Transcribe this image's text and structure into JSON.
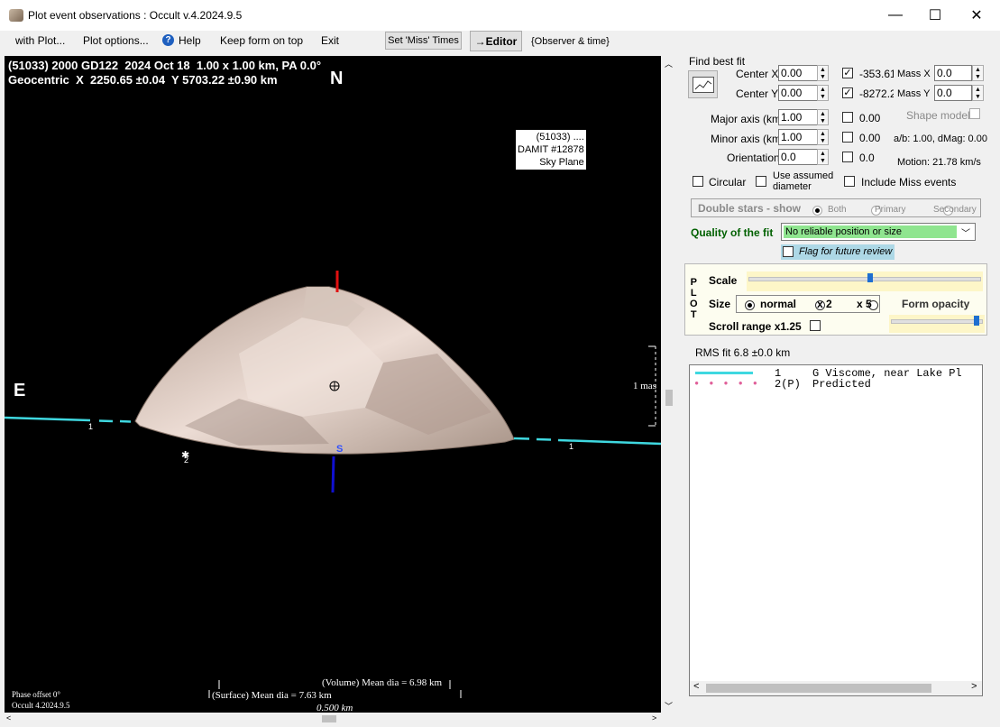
{
  "window": {
    "title": "Plot event observations : Occult v.4.2024.9.5",
    "minimize": "—",
    "maximize": "☐",
    "close": "✕"
  },
  "menu": {
    "with_plot": "with Plot...",
    "plot_options": "Plot options...",
    "help": "Help",
    "keep_form": "Keep form on top",
    "exit": "Exit"
  },
  "toolbar": {
    "set_miss": "Set 'Miss' Times",
    "editor": "→Editor",
    "observer_time": "{Observer & time}"
  },
  "plot": {
    "header_line1": "(51033) 2000 GD122  2024 Oct 18  1.00 x 1.00 km, PA 0.0°",
    "header_line2": "Geocentric  X  2250.65 ±0.04  Y 5703.22 ±0.90 km",
    "north": "N",
    "east": "E",
    "south": "S",
    "label_box": [
      "(51033) ....",
      "DAMIT #12878",
      "Sky Plane"
    ],
    "scale_mas": "1 mas",
    "chord_label_left": "1",
    "chord_label_right": "1",
    "predicted_label": "2",
    "volume_dia": "(Volume) Mean dia = 6.98 km",
    "surface_dia": "(Surface) Mean dia = 7.63 km",
    "scale_km": "0.500 km",
    "phase_offset": "Phase offset 0°",
    "version": "Occult 4.2024.9.5",
    "colors": {
      "chord": "#3fd8e0",
      "north_marker": "#e01010",
      "south_marker": "#1010d0",
      "shape": "#c8b2a6"
    }
  },
  "fit": {
    "find_best_fit": "Find best fit",
    "center_x_label": "Center X",
    "center_x": "0.00",
    "center_y_label": "Center Y",
    "center_y": "0.00",
    "center_x_check_value": "-353.61",
    "center_y_check_value": "-8272.24",
    "mass_x_label": "Mass X",
    "mass_x": "0.0",
    "mass_y_label": "Mass Y",
    "mass_y": "0.0",
    "major_label": "Major axis (km)",
    "major": "1.00",
    "major_check_value": "0.00",
    "minor_label": "Minor axis (km)",
    "minor": "1.00",
    "minor_check_value": "0.00",
    "orientation_label": "Orientation",
    "orientation": "0.0",
    "orientation_check_value": "0.0",
    "shape_model": "Shape model",
    "ab_dmag": "a/b: 1.00, dMag: 0.00",
    "motion": "Motion: 21.78 km/s",
    "circular": "Circular",
    "use_assumed": "Use assumed diameter",
    "include_miss": "Include Miss events"
  },
  "double_stars": {
    "label": "Double stars - show",
    "both": "Both",
    "primary": "Primary",
    "secondary": "Secondary"
  },
  "quality": {
    "label": "Quality of the fit",
    "value": "No reliable position or size",
    "flag": "Flag for future review",
    "value_color": "#8fe58f"
  },
  "plot_panel": {
    "side_letters": [
      "P",
      "L",
      "O",
      "T"
    ],
    "scale": "Scale",
    "size": "Size",
    "normal": "normal",
    "x2": "x 2",
    "x5": "x 5",
    "form_opacity": "Form opacity",
    "scroll_range": "Scroll range x1.25"
  },
  "rms": "RMS fit 6.8 ±0.0 km",
  "legend": [
    {
      "num": "1",
      "text": "G Viscome, near Lake Pl"
    },
    {
      "num": "2(P)",
      "text": "Predicted"
    }
  ]
}
